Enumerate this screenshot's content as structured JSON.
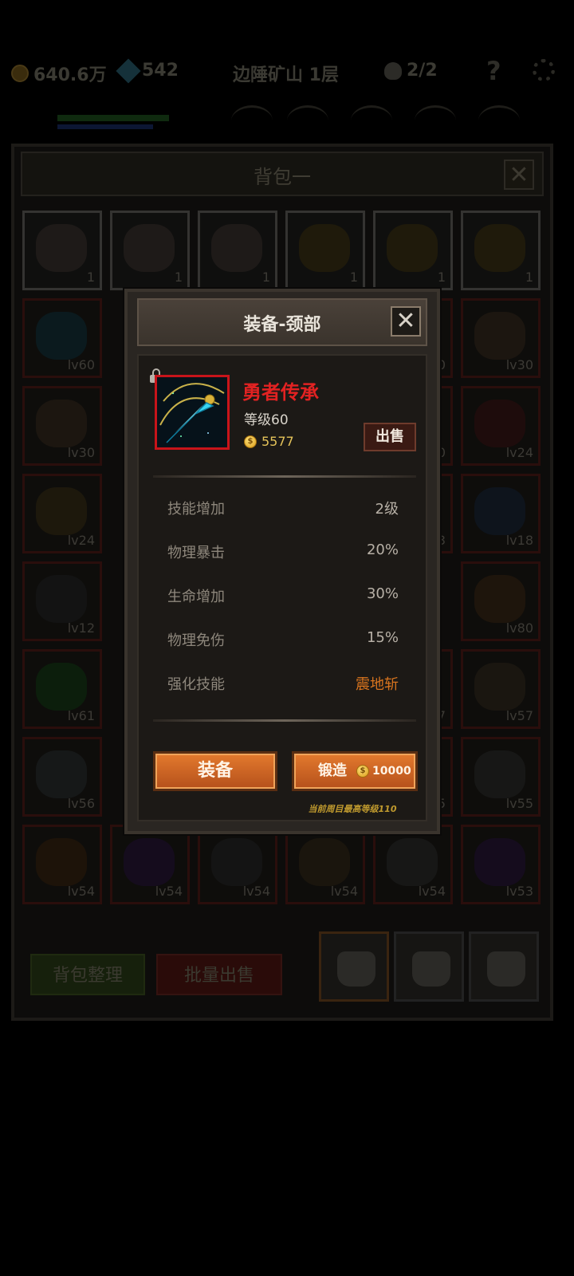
{
  "hud": {
    "gold": "640.6万",
    "gems": "542",
    "location": "边陲矿山 1层",
    "skulls": "2/2",
    "help_icon": "question-icon",
    "settings_icon": "gear-icon"
  },
  "backpack": {
    "title": "背包一",
    "consumables": [
      {
        "name": "cake-icon",
        "count": "1"
      },
      {
        "name": "cake-icon",
        "count": "1"
      },
      {
        "name": "cake-icon",
        "count": "1"
      },
      {
        "name": "beer-mug-icon",
        "count": "1"
      },
      {
        "name": "beer-mug-icon",
        "count": "1"
      },
      {
        "name": "beer-mug-icon",
        "count": "1"
      }
    ],
    "equipment_levels": {
      "row1": [
        "lv60",
        "",
        "",
        "",
        "0",
        "lv30"
      ],
      "row2": [
        "lv30",
        "",
        "",
        "",
        "0",
        "lv24"
      ],
      "row3": [
        "lv24",
        "",
        "",
        "",
        "3",
        "lv18"
      ],
      "row4": [
        "lv12",
        "",
        "",
        "",
        "",
        "lv80"
      ],
      "row5": [
        "lv61",
        "",
        "",
        "",
        "7",
        "lv57"
      ],
      "row6": [
        "lv56",
        "",
        "",
        "",
        "5",
        "lv55"
      ],
      "row7": [
        "lv54",
        "lv54",
        "lv54",
        "lv54",
        "lv54",
        "lv53"
      ]
    },
    "sort_button": "背包整理",
    "bulk_sell_button": "批量出售"
  },
  "dialog": {
    "title": "装备-颈部",
    "item": {
      "name": "勇者传承",
      "level": "等级60",
      "price": "5577",
      "sell_button": "出售"
    },
    "stats": [
      {
        "label": "技能增加",
        "value": "2级"
      },
      {
        "label": "物理暴击",
        "value": "20%"
      },
      {
        "label": "生命增加",
        "value": "30%"
      },
      {
        "label": "物理免伤",
        "value": "15%"
      },
      {
        "label": "强化技能",
        "value": "震地斩"
      }
    ],
    "equip_button": "装备",
    "forge_button": "锻造",
    "forge_cost": "10000",
    "max_level_note": "当前周目最高等级110"
  },
  "colors": {
    "item_name": "#e22222",
    "skill_value": "#d8741e",
    "button_orange": "#d8692a",
    "gold_text": "#e5c35a"
  }
}
